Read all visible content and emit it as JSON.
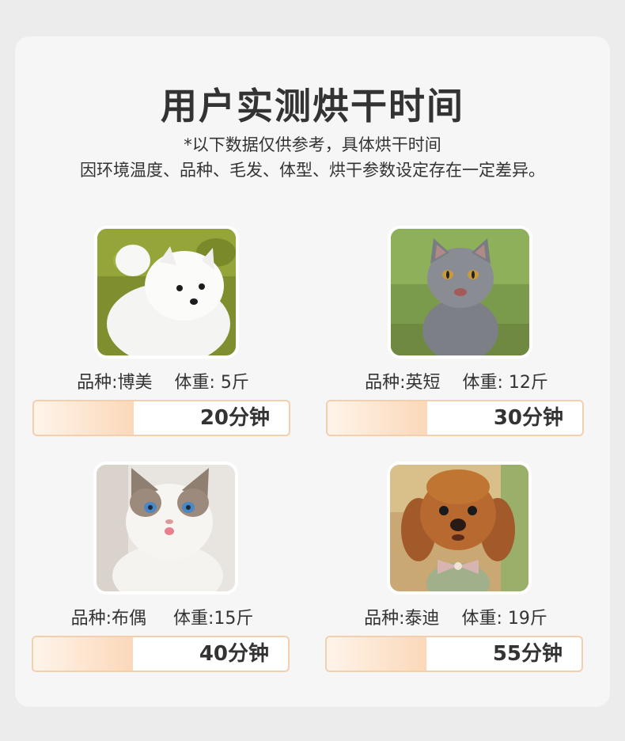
{
  "title": "用户实测烘干时间",
  "note_line1": "*以下数据仅供参考，具体烘干时间",
  "note_line2": "因环境温度、品种、毛发、体型、烘干参数设定存在一定差异。",
  "pets": [
    {
      "breed": "品种:博美",
      "weight": "体重: 5斤",
      "time": "20分钟",
      "progress": 0.39,
      "photo": "white-pomeranian-dog"
    },
    {
      "breed": "品种:英短",
      "weight": "体重: 12斤",
      "time": "30分钟",
      "progress": 0.39,
      "photo": "grey-british-shorthair-cat"
    },
    {
      "breed": "品种:布偶",
      "weight": "体重:15斤",
      "time": "40分钟",
      "progress": 0.39,
      "photo": "ragdoll-cat"
    },
    {
      "breed": "品种:泰迪",
      "weight": "体重: 19斤",
      "time": "55分钟",
      "progress": 0.39,
      "photo": "brown-teddy-poodle"
    }
  ]
}
